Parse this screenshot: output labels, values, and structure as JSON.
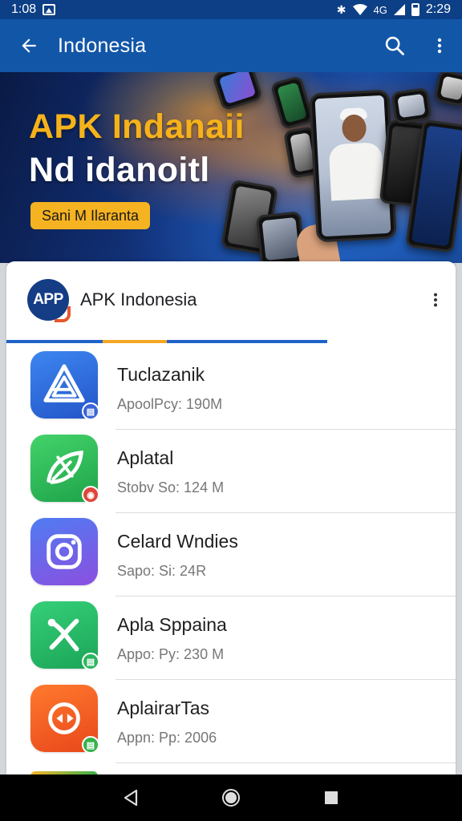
{
  "status_bar": {
    "time": "1:08",
    "signal": "4G",
    "clock": "2:29"
  },
  "app_bar": {
    "title": "Indonesia",
    "back_icon": "arrow-left-icon",
    "search_icon": "search-icon",
    "more_icon": "more-vert-icon"
  },
  "banner": {
    "title_line1": "APK Indanaii",
    "title_line2": "Nd idanoitl",
    "pill_label": "Sani M Ilaranta",
    "colors": {
      "title1": "#f6b21a",
      "title2": "#ffffff",
      "pill": "#f5b321"
    }
  },
  "card": {
    "logo_text": "APP",
    "title": "APK Indonesia",
    "more_icon": "more-vert-icon"
  },
  "apps": [
    {
      "name": "Tuclazanik",
      "meta": "ApoolPcy: 190M",
      "icon": "triangle-logo-icon",
      "color": "#2f6fe0",
      "badge_color": "#3a64d8"
    },
    {
      "name": "Aplatal",
      "meta": "Stobv So: 124 M",
      "icon": "leaf-logo-icon",
      "color": "#2fbe5b",
      "badge_color": "#e0443a"
    },
    {
      "name": "Celard Wndies",
      "meta": "Sapo: Si: 24R",
      "icon": "camera-logo-icon",
      "color": "#6a55e0",
      "badge_color": "#ffffff"
    },
    {
      "name": "Apla Sppaina",
      "meta": "Appo: Py: 230 M",
      "icon": "scissors-logo-icon",
      "color": "#27b866",
      "badge_color": "#2bb55d"
    },
    {
      "name": "AplairarTas",
      "meta": "Appn: Pp: 2006",
      "icon": "bird-logo-icon",
      "color": "#f25c1f",
      "badge_color": "#35b24a"
    }
  ],
  "nav_bar": {
    "back_icon": "nav-back-icon",
    "home_icon": "nav-home-icon",
    "recents_icon": "nav-recents-icon"
  }
}
